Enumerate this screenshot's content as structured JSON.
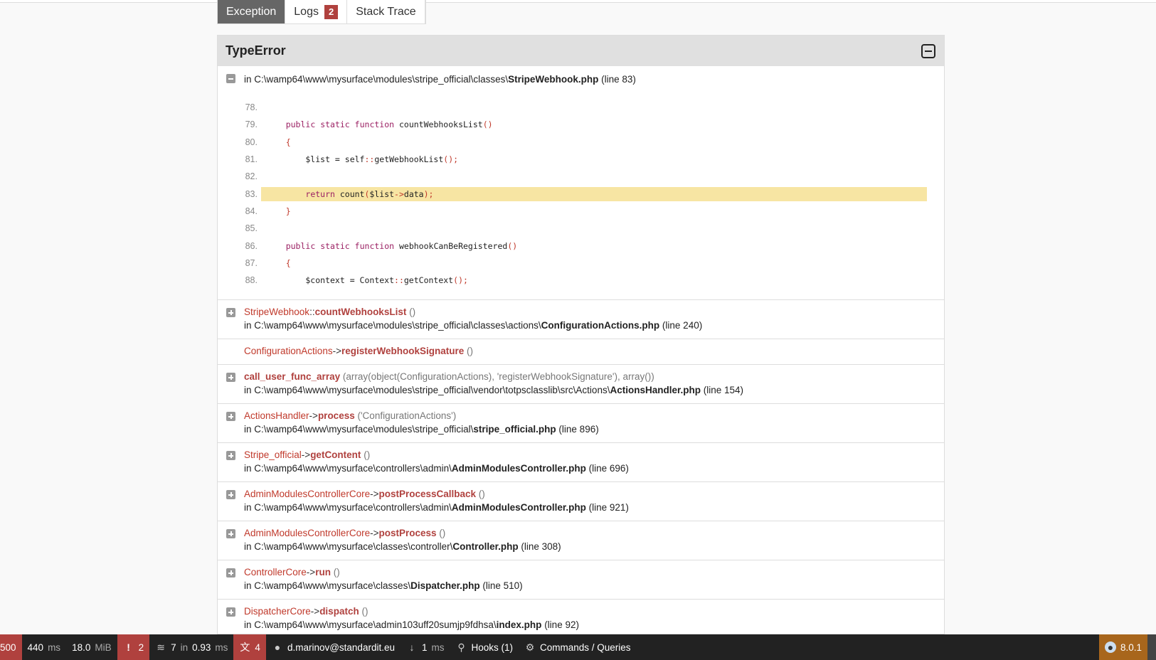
{
  "tabs": [
    {
      "label": "Exception",
      "active": true
    },
    {
      "label": "Logs",
      "badge": "2"
    },
    {
      "label": "Stack Trace"
    }
  ],
  "exception": {
    "title": "TypeError",
    "file_prefix": "in C:\\wamp64\\www\\mysurface\\modules\\stripe_official\\classes\\",
    "file_name": "StripeWebhook.php",
    "line": "(line 83)",
    "code": [
      {
        "n": "78.",
        "src": ""
      },
      {
        "n": "79.",
        "src": "    public static function countWebhooksList()"
      },
      {
        "n": "80.",
        "src": "    {"
      },
      {
        "n": "81.",
        "src": "        $list = self::getWebhookList();"
      },
      {
        "n": "82.",
        "src": ""
      },
      {
        "n": "83.",
        "src": "        return count($list->data);",
        "highlight": true
      },
      {
        "n": "84.",
        "src": "    }"
      },
      {
        "n": "85.",
        "src": ""
      },
      {
        "n": "86.",
        "src": "    public static function webhookCanBeRegistered()"
      },
      {
        "n": "87.",
        "src": "    {"
      },
      {
        "n": "88.",
        "src": "        $context = Context::getContext();"
      }
    ]
  },
  "frames": [
    {
      "cls": "StripeWebhook",
      "op": "::",
      "meth": "countWebhooksList",
      "args": "()",
      "dir": "in C:\\wamp64\\www\\mysurface\\modules\\stripe_official\\classes\\actions\\",
      "file": "ConfigurationActions.php",
      "line": "(line 240)"
    },
    {
      "cls": "ConfigurationActions",
      "op": "->",
      "meth": "registerWebhookSignature",
      "args": "()"
    },
    {
      "cls": "",
      "op": "",
      "meth": "call_user_func_array",
      "args": "(array(object(ConfigurationActions), 'registerWebhookSignature'), array())",
      "dir": "in C:\\wamp64\\www\\mysurface\\modules\\stripe_official\\vendor\\totpsclasslib\\src\\Actions\\",
      "file": "ActionsHandler.php",
      "line": "(line 154)"
    },
    {
      "cls": "ActionsHandler",
      "op": "->",
      "meth": "process",
      "args": "('ConfigurationActions')",
      "dir": "in C:\\wamp64\\www\\mysurface\\modules\\stripe_official\\",
      "file": "stripe_official.php",
      "line": "(line 896)"
    },
    {
      "cls": "Stripe_official",
      "op": "->",
      "meth": "getContent",
      "args": "()",
      "dir": "in C:\\wamp64\\www\\mysurface\\controllers\\admin\\",
      "file": "AdminModulesController.php",
      "line": "(line 696)"
    },
    {
      "cls": "AdminModulesControllerCore",
      "op": "->",
      "meth": "postProcessCallback",
      "args": "()",
      "dir": "in C:\\wamp64\\www\\mysurface\\controllers\\admin\\",
      "file": "AdminModulesController.php",
      "line": "(line 921)"
    },
    {
      "cls": "AdminModulesControllerCore",
      "op": "->",
      "meth": "postProcess",
      "args": "()",
      "dir": "in C:\\wamp64\\www\\mysurface\\classes\\controller\\",
      "file": "Controller.php",
      "line": "(line 308)"
    },
    {
      "cls": "ControllerCore",
      "op": "->",
      "meth": "run",
      "args": "()",
      "dir": "in C:\\wamp64\\www\\mysurface\\classes\\",
      "file": "Dispatcher.php",
      "line": "(line 510)"
    },
    {
      "cls": "DispatcherCore",
      "op": "->",
      "meth": "dispatch",
      "args": "()",
      "dir": "in C:\\wamp64\\www\\mysurface\\admin103uff20sumjp9fdhsa\\",
      "file": "index.php",
      "line": "(line 92)"
    }
  ],
  "toolbar": {
    "status": "500",
    "time": "440",
    "time_unit": "ms",
    "memory": "18.0",
    "memory_unit": "MiB",
    "exceptions": "2",
    "db": "7",
    "db_mid": "in",
    "db_time": "0.93",
    "db_unit": "ms",
    "translations": "4",
    "user": "d.marinov@standardit.eu",
    "request_time": "1",
    "request_unit": "ms",
    "hooks": "Hooks (1)",
    "commands": "Commands / Queries",
    "version": "8.0.1"
  },
  "colors": {
    "accent_red": "#b0413e",
    "highlight": "#f7e5a3",
    "toolbar_bg": "#222222",
    "version_bg": "#a8661c"
  }
}
